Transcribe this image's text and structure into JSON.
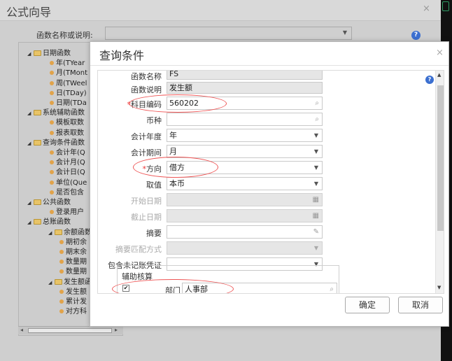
{
  "wizard": {
    "title": "公式向导",
    "close_glyph": "×",
    "function_label": "函数名称或说明:",
    "function_select_value": "",
    "tree": [
      {
        "label": "日期函数",
        "level": 0,
        "kind": "folder"
      },
      {
        "label": "年(TYear",
        "level": 1,
        "kind": "leaf"
      },
      {
        "label": "月(TMont",
        "level": 1,
        "kind": "leaf"
      },
      {
        "label": "周(TWeel",
        "level": 1,
        "kind": "leaf"
      },
      {
        "label": "日(TDay)",
        "level": 1,
        "kind": "leaf"
      },
      {
        "label": "日期(TDa",
        "level": 1,
        "kind": "leaf"
      },
      {
        "label": "系统辅助函数",
        "level": 0,
        "kind": "folder"
      },
      {
        "label": "模板取数",
        "level": 1,
        "kind": "leaf"
      },
      {
        "label": "报表取数",
        "level": 1,
        "kind": "leaf"
      },
      {
        "label": "查询条件函数",
        "level": 0,
        "kind": "folder"
      },
      {
        "label": "会计年(Q",
        "level": 1,
        "kind": "leaf"
      },
      {
        "label": "会计月(Q",
        "level": 1,
        "kind": "leaf"
      },
      {
        "label": "会计日(Q",
        "level": 1,
        "kind": "leaf"
      },
      {
        "label": "单位(Que",
        "level": 1,
        "kind": "leaf"
      },
      {
        "label": "是否包含",
        "level": 1,
        "kind": "leaf"
      },
      {
        "label": "公共函数",
        "level": 0,
        "kind": "folder"
      },
      {
        "label": "登录用户",
        "level": 1,
        "kind": "leaf"
      },
      {
        "label": "总账函数",
        "level": 0,
        "kind": "folder"
      },
      {
        "label": "余额函数",
        "level": 1,
        "kind": "folder"
      },
      {
        "label": "期初余",
        "level": 2,
        "kind": "leaf"
      },
      {
        "label": "期末余",
        "level": 2,
        "kind": "leaf"
      },
      {
        "label": "数量期",
        "level": 2,
        "kind": "leaf"
      },
      {
        "label": "数量期",
        "level": 2,
        "kind": "leaf"
      },
      {
        "label": "发生额函数",
        "level": 1,
        "kind": "folder"
      },
      {
        "label": "发生额",
        "level": 2,
        "kind": "leaf"
      },
      {
        "label": "累计发",
        "level": 2,
        "kind": "leaf"
      },
      {
        "label": "对方科",
        "level": 2,
        "kind": "leaf"
      }
    ]
  },
  "dialog": {
    "title": "查询条件",
    "close_glyph": "×",
    "fields": {
      "func_name": {
        "label": "函数名称",
        "value": "FS"
      },
      "func_desc": {
        "label": "函数说明",
        "value": "发生额"
      },
      "subject_code": {
        "label": "科目编码",
        "value": "560202",
        "required_mark": "*"
      },
      "currency": {
        "label": "币种",
        "value": ""
      },
      "fiscal_year": {
        "label": "会计年度",
        "value": "年"
      },
      "fiscal_period": {
        "label": "会计期间",
        "value": "月"
      },
      "direction": {
        "label": "方向",
        "value": "借方",
        "required_mark": "*"
      },
      "value_type": {
        "label": "取值",
        "value": "本币"
      },
      "start_date": {
        "label": "开始日期",
        "value": ""
      },
      "end_date": {
        "label": "截止日期",
        "value": ""
      },
      "summary": {
        "label": "摘要",
        "value": ""
      },
      "summary_match": {
        "label": "摘要匹配方式",
        "value": ""
      },
      "include_unposted": {
        "label": "包含未记账凭证",
        "value": ""
      }
    },
    "aux": {
      "title": "辅助核算",
      "checked_glyph": "✔",
      "department_label": "部门",
      "department_value": "人事部"
    },
    "ok_label": "确定",
    "cancel_label": "取消"
  },
  "icons": {
    "help": "?",
    "caret": "▼",
    "search": "🔍",
    "calendar": "▦"
  },
  "colors": {
    "annotation": "#e55555",
    "help": "#3b6fd0",
    "required": "#ee3333"
  }
}
